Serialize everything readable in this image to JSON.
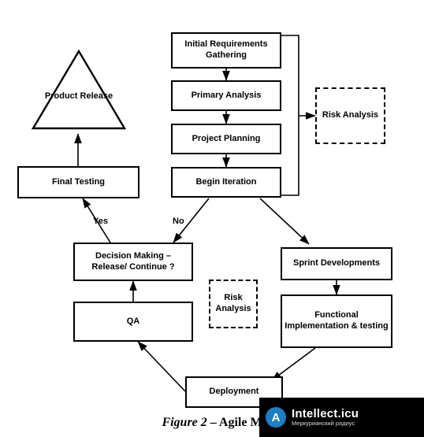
{
  "figure": {
    "caption_prefix": "Figure 2",
    "caption_rest": " – Agile M"
  },
  "nodes": {
    "initial_requirements": "Initial Requirements Gathering",
    "primary_analysis": "Primary Analysis",
    "project_planning": "Project Planning",
    "begin_iteration": "Begin Iteration",
    "risk_analysis_top": "Risk Analysis",
    "product_release": "Product Release",
    "final_testing": "Final Testing",
    "decision_making": "Decision Making – Release/ Continue ?",
    "risk_analysis_center": "Risk Analysis",
    "sprint_developments": "Sprint Developments",
    "qa": "QA",
    "functional_implementation": "Functional Implementation & testing",
    "deployment": "Deployment"
  },
  "edge_labels": {
    "yes": "Yes",
    "no": "No"
  },
  "watermark": {
    "badge": "A",
    "title": "Intellect.icu",
    "subtitle": "Меркурианский радиус"
  }
}
